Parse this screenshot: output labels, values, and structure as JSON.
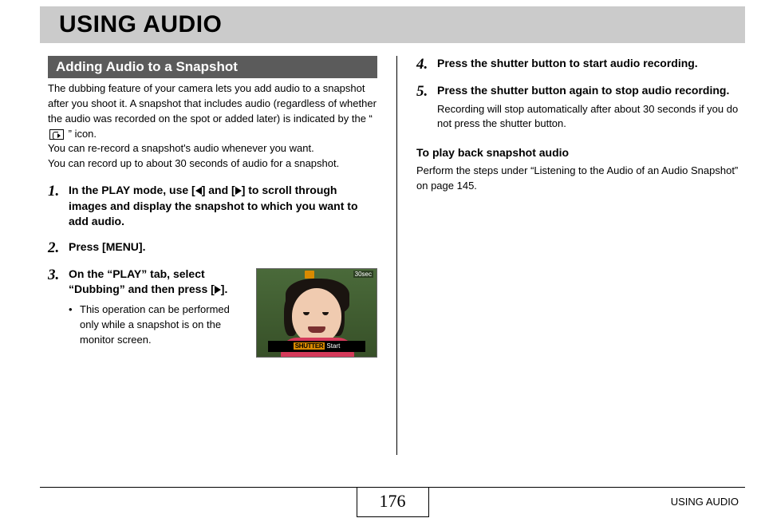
{
  "page": {
    "title": "USING AUDIO",
    "number": "176",
    "footer_caption": "USING AUDIO"
  },
  "section": {
    "heading": "Adding Audio to a Snapshot",
    "intro_a": "The dubbing feature of your camera lets you add audio to a snapshot after you shoot it. A snapshot that includes audio (regardless of whether the audio was recorded on the spot or added later) is indicated by the “",
    "intro_b": "” icon.",
    "intro_c": "You can re-record a snapshot's audio whenever you want.",
    "intro_d": "You can record up to about 30 seconds of audio for a snapshot."
  },
  "steps": [
    {
      "num": "1.",
      "title_a": "In the PLAY mode, use [",
      "title_b": "] and [",
      "title_c": "] to scroll through images and display the snapshot to which you want to add audio."
    },
    {
      "num": "2.",
      "title": "Press [MENU]."
    },
    {
      "num": "3.",
      "title_a": "On the “PLAY” tab, select “Dubbing” and then press [",
      "title_b": "].",
      "bullet": "This operation can be performed only while a snapshot is on the monitor screen."
    },
    {
      "num": "4.",
      "title": "Press the shutter button to start audio recording."
    },
    {
      "num": "5.",
      "title": "Press the shutter button again to stop audio recording.",
      "sub": "Recording will stop automatically after about 30 seconds if you do not press the shutter button."
    }
  ],
  "screenshot": {
    "top_badge": "30sec",
    "shutter_label": "SHUTTER",
    "start_label": "Start"
  },
  "playback": {
    "heading": "To play back snapshot audio",
    "text": "Perform the steps under “Listening to the Audio of an Audio Snapshot” on page 145."
  }
}
